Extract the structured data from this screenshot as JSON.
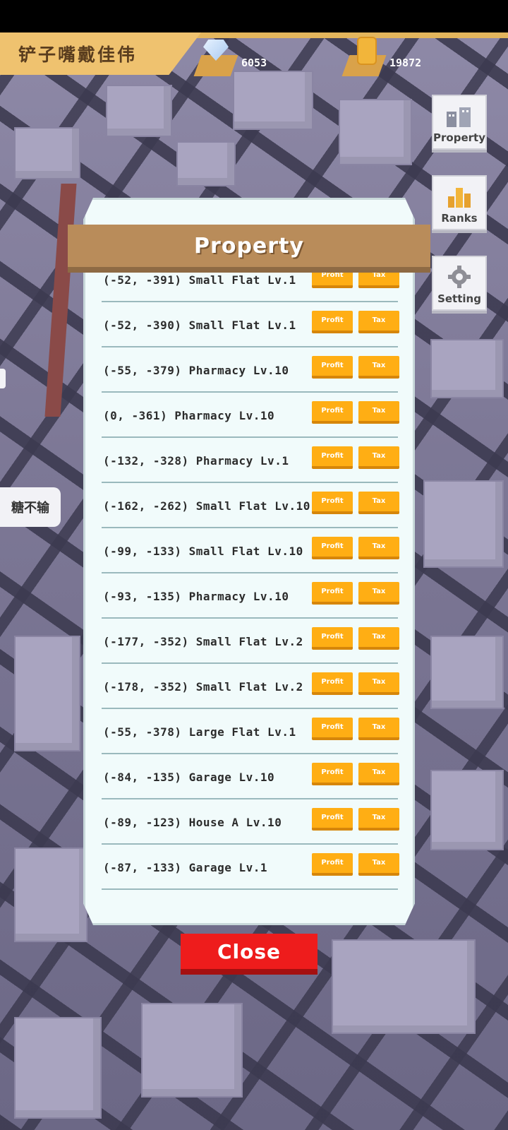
{
  "player": {
    "name": "铲子嘴戴佳伟"
  },
  "resources": {
    "diamonds": "6053",
    "coins": "19872"
  },
  "side_menu": {
    "property": "Property",
    "ranks": "Ranks",
    "setting": "Setting"
  },
  "bubble_text": "糖不输",
  "panel": {
    "title": "Property",
    "profit_label": "Profit",
    "tax_label": "Tax",
    "rows": [
      "(-52, -391) Small Flat Lv.1",
      "(-52, -390) Small Flat Lv.1",
      "(-55, -379) Pharmacy Lv.10",
      "(0, -361) Pharmacy Lv.10",
      "(-132, -328) Pharmacy Lv.1",
      "(-162, -262) Small Flat Lv.10",
      "(-99, -133) Small Flat Lv.10",
      "(-93, -135) Pharmacy Lv.10",
      "(-177, -352) Small Flat Lv.2",
      "(-178, -352) Small Flat Lv.2",
      "(-55, -378) Large Flat Lv.1",
      "(-84, -135) Garage Lv.10",
      "(-89, -123) House A Lv.10",
      "(-87, -133) Garage Lv.1"
    ],
    "close_label": "Close"
  },
  "colors": {
    "accent_orange": "#ffae14",
    "close_red": "#ee1c1c",
    "title_brown": "#b98c5a",
    "banner_gold": "#efc26f"
  }
}
